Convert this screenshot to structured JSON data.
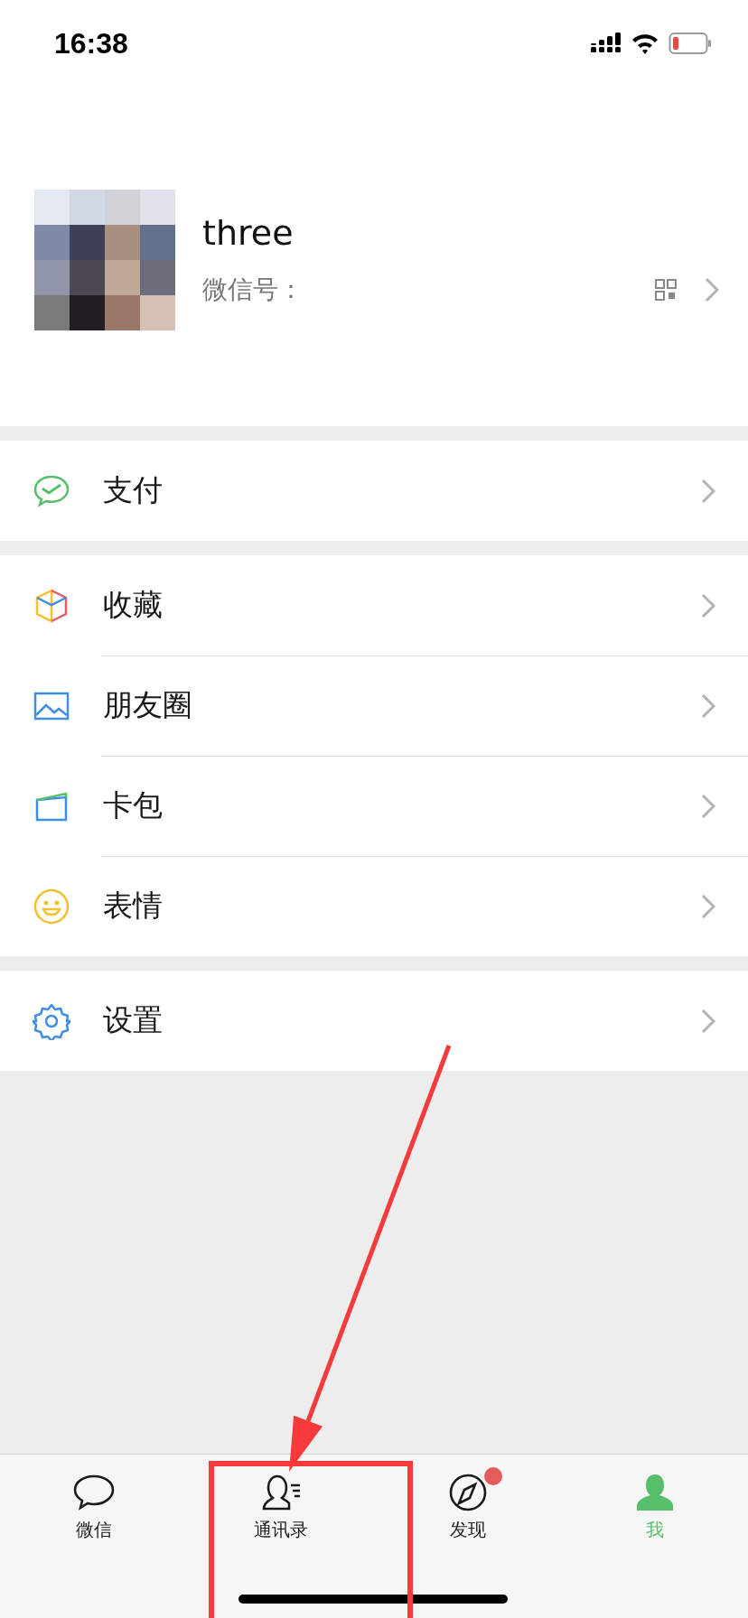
{
  "status_bar": {
    "time": "16:38"
  },
  "profile": {
    "name": "three",
    "id_label": "微信号："
  },
  "sections": [
    {
      "items": [
        {
          "kind": "pay",
          "label": "支付"
        }
      ]
    },
    {
      "items": [
        {
          "kind": "favorites",
          "label": "收藏"
        },
        {
          "kind": "moments",
          "label": "朋友圈"
        },
        {
          "kind": "cards",
          "label": "卡包"
        },
        {
          "kind": "stickers",
          "label": "表情"
        }
      ]
    },
    {
      "items": [
        {
          "kind": "settings",
          "label": "设置"
        }
      ]
    }
  ],
  "tabs": [
    {
      "kind": "chats",
      "label": "微信",
      "selected": false,
      "badge": false
    },
    {
      "kind": "contacts",
      "label": "通讯录",
      "selected": false,
      "badge": false
    },
    {
      "kind": "discover",
      "label": "发现",
      "selected": false,
      "badge": true
    },
    {
      "kind": "me",
      "label": "我",
      "selected": true,
      "badge": false
    }
  ],
  "annotations": [
    {
      "kind": "arrow"
    },
    {
      "kind": "frame"
    }
  ]
}
